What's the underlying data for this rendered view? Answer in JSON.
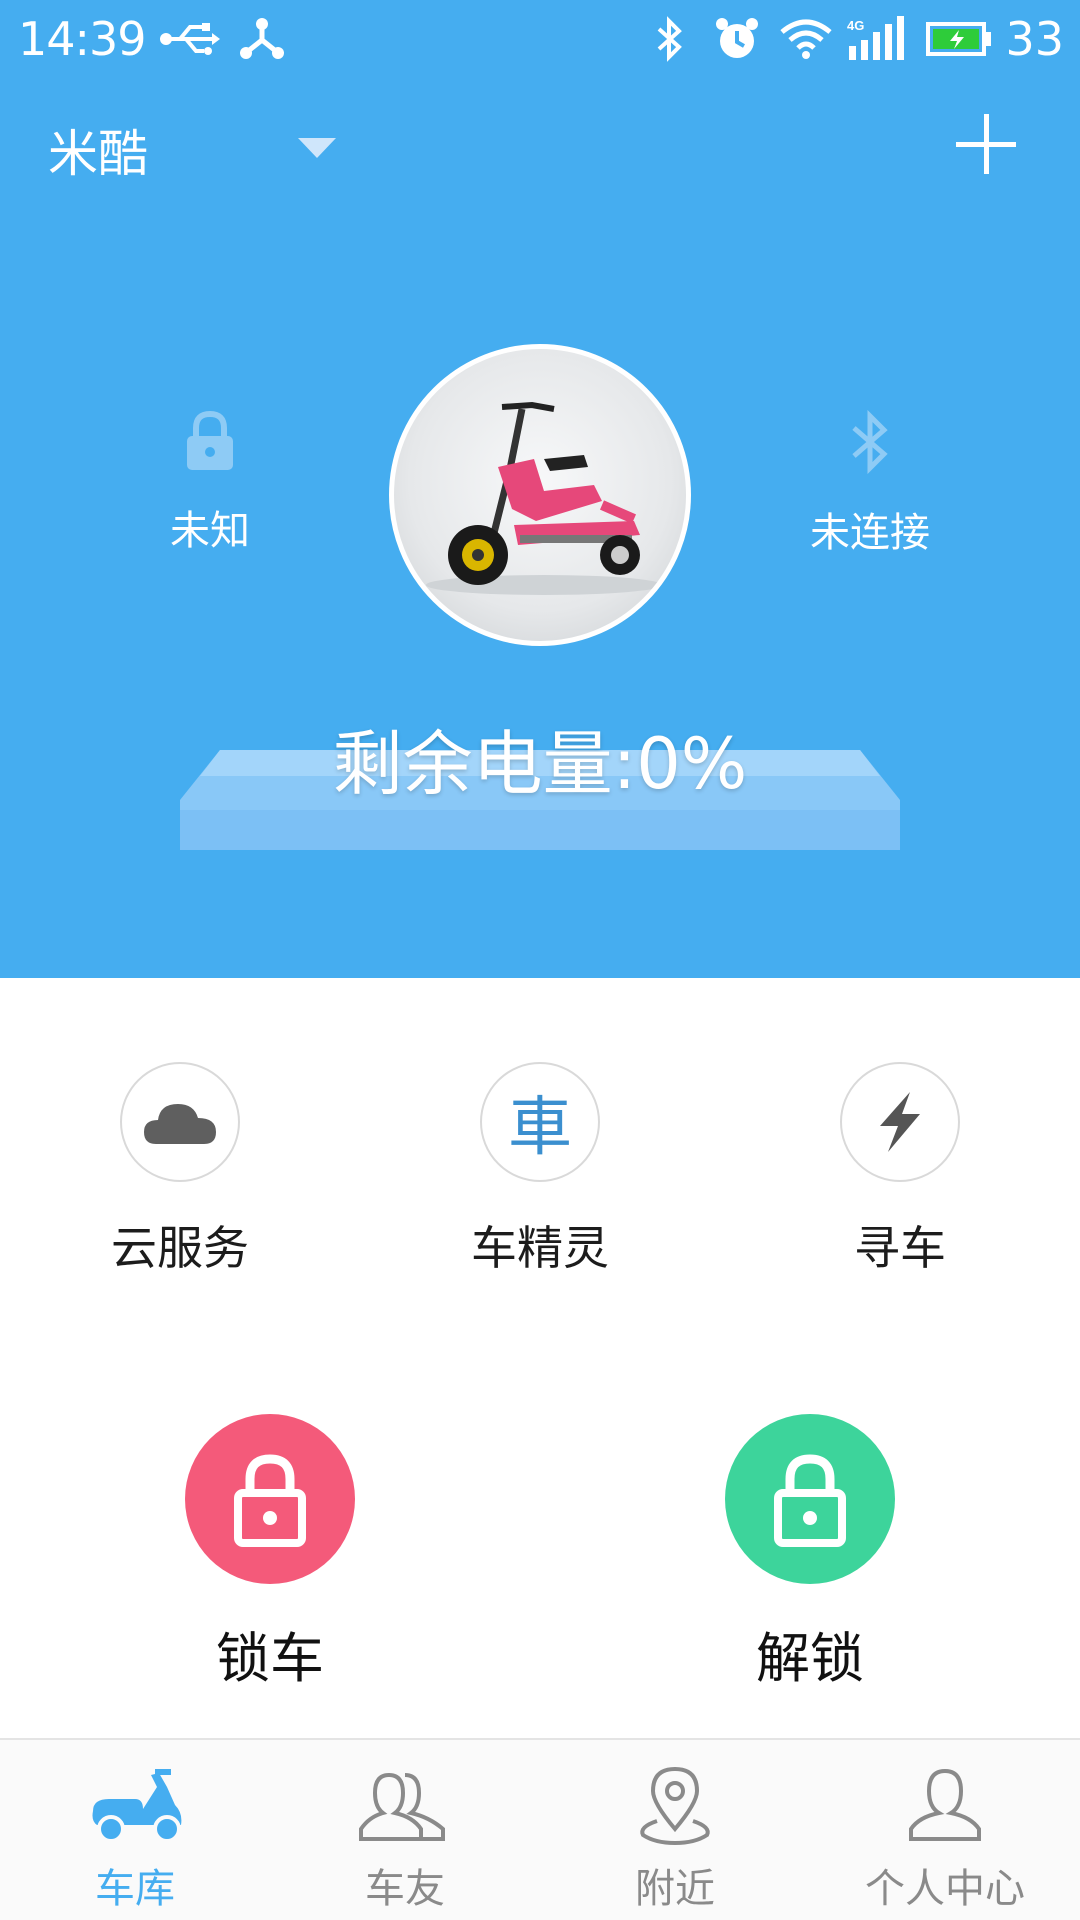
{
  "status_bar": {
    "time": "14:39",
    "battery_level": "33",
    "icons": [
      "usb-icon",
      "share-icon",
      "bluetooth-icon",
      "alarm-icon",
      "wifi-icon",
      "4g-signal-icon",
      "battery-charging-icon"
    ]
  },
  "header": {
    "title": "米酷",
    "dropdown_icon": "dropdown-caret-icon",
    "add_icon": "plus-icon"
  },
  "vehicle": {
    "lock_status_label": "未知",
    "lock_status_icon": "padlock-icon",
    "connection_label": "未连接",
    "connection_icon": "bluetooth-icon",
    "battery_text": "剩余电量:0%",
    "battery_percent": 0
  },
  "functions": [
    {
      "label": "云服务",
      "icon": "cloud-icon"
    },
    {
      "label": "车精灵",
      "icon": "car-character-icon",
      "glyph": "車"
    },
    {
      "label": "寻车",
      "icon": "lightning-icon"
    }
  ],
  "actions": {
    "lock_label": "锁车",
    "unlock_label": "解锁",
    "lock_color": "#f45a7a",
    "unlock_color": "#3dd49b"
  },
  "bottom_nav": [
    {
      "label": "车库",
      "icon": "scooter-icon",
      "active": true
    },
    {
      "label": "车友",
      "icon": "friends-icon",
      "active": false
    },
    {
      "label": "附近",
      "icon": "location-pin-icon",
      "active": false
    },
    {
      "label": "个人中心",
      "icon": "person-icon",
      "active": false
    }
  ],
  "colors": {
    "primary": "#45adf0",
    "nav_inactive": "#8a8a8a"
  }
}
